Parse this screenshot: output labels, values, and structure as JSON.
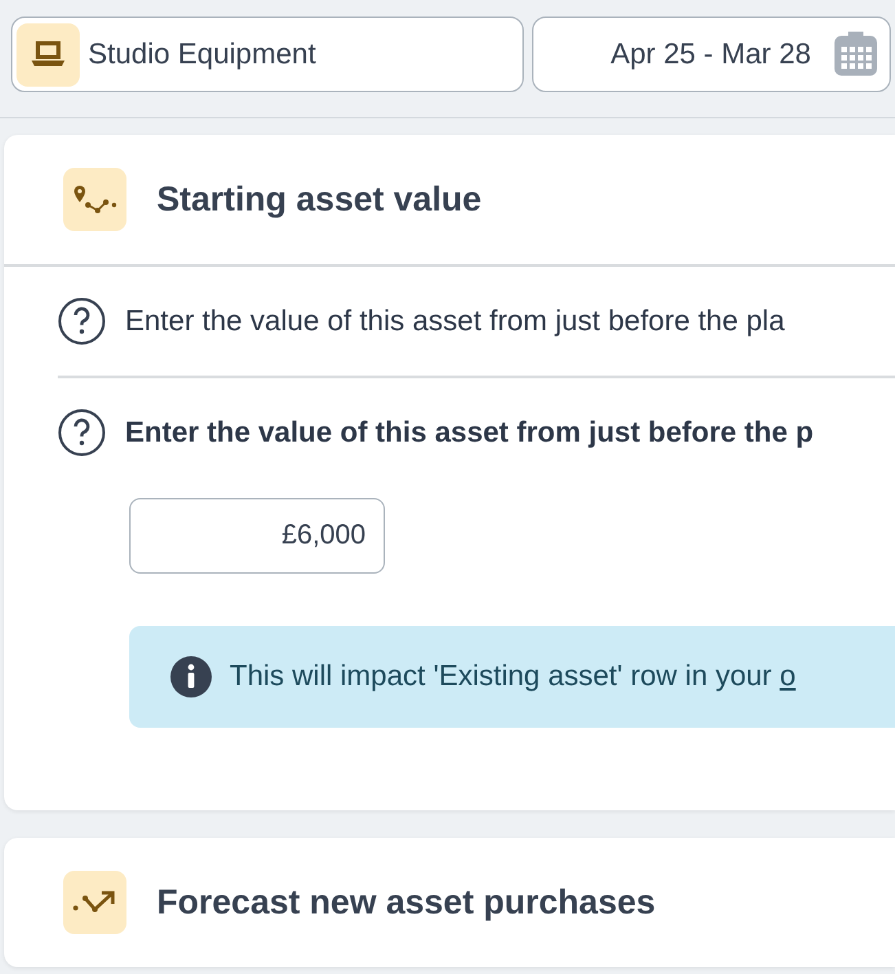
{
  "asset_selector": {
    "label": "Studio Equipment"
  },
  "date_range": {
    "label": "Apr 25 - Mar 28"
  },
  "sections": [
    {
      "title": "Starting asset value",
      "questions": [
        {
          "text": "Enter the value of this asset from just before the pla",
          "emphasized": false
        },
        {
          "text": "Enter the value of this asset from just before the p",
          "emphasized": true,
          "value": "£6,000",
          "info": {
            "text": "This will impact 'Existing asset' row in your ",
            "link": "o"
          }
        }
      ]
    },
    {
      "title": "Forecast new asset purchases"
    }
  ]
}
